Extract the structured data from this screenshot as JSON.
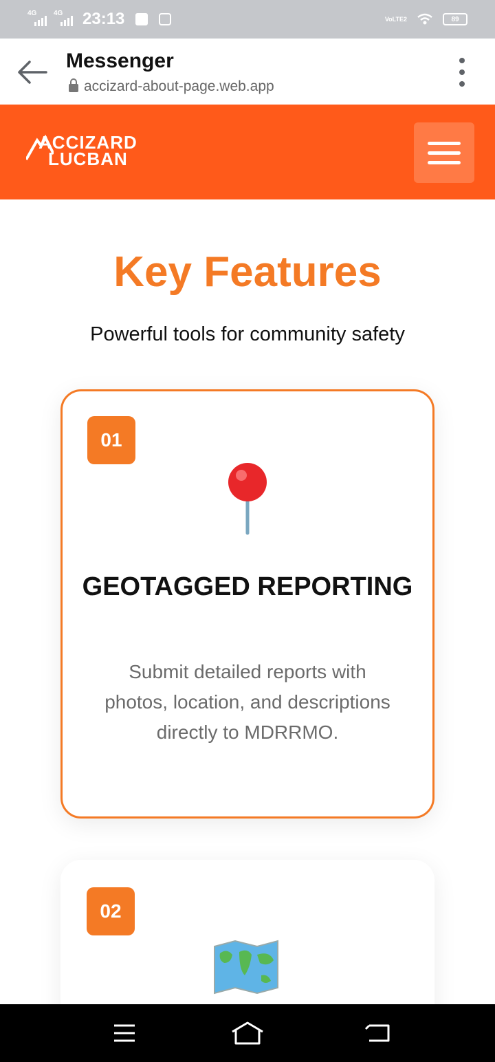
{
  "status_bar": {
    "network_1": "4G",
    "network_2": "4G",
    "time": "23:13",
    "lte_label": "VoLTE2",
    "battery": "89"
  },
  "browser": {
    "title": "Messenger",
    "url": "accizard-about-page.web.app"
  },
  "site": {
    "logo_line1": "ACCIZARD",
    "logo_line2": "LUCBAN",
    "brand_color": "#ff5a1a",
    "accent_color": "#f47a25"
  },
  "section": {
    "title": "Key Features",
    "subtitle": "Powerful tools for community safety"
  },
  "features": [
    {
      "number": "01",
      "icon": "pushpin-icon",
      "title": "GEOTAGGED REPORTING",
      "description": "Submit detailed reports with photos, location, and descriptions directly to MDRRMO."
    },
    {
      "number": "02",
      "icon": "world-map-icon"
    }
  ]
}
